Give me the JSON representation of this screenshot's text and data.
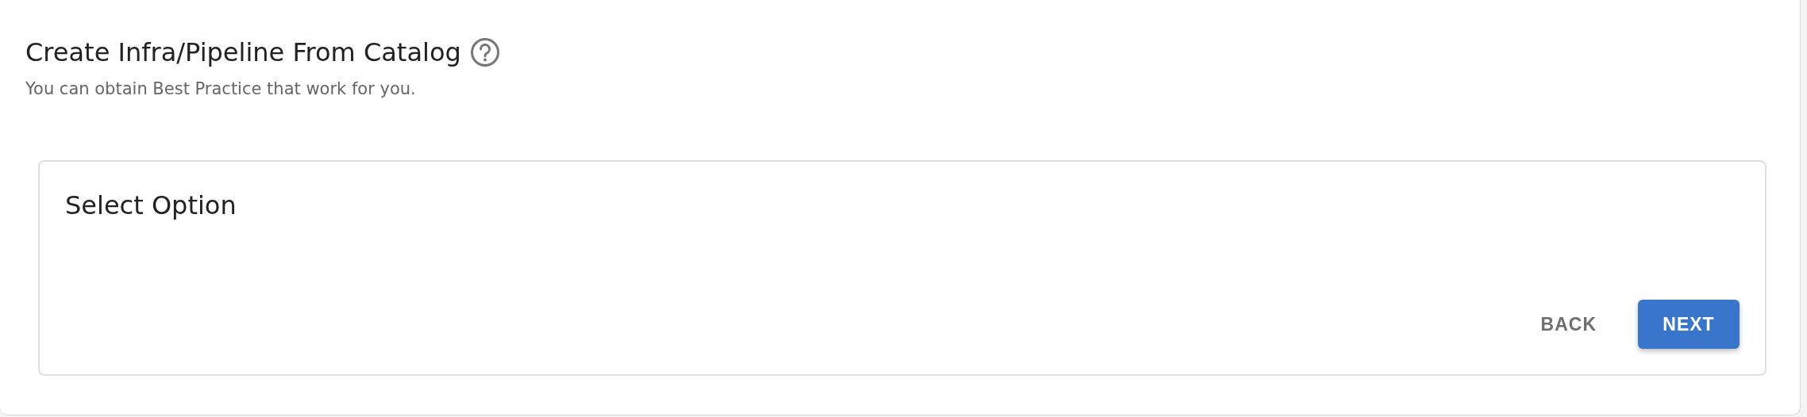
{
  "header": {
    "title": "Create Infra/Pipeline From Catalog",
    "subtitle": "You can obtain Best Practice that work for you."
  },
  "card": {
    "title": "Select Option"
  },
  "buttons": [
    {
      "label": "BACK",
      "kind": "text"
    },
    {
      "label": "NEXT",
      "kind": "primary"
    }
  ]
}
